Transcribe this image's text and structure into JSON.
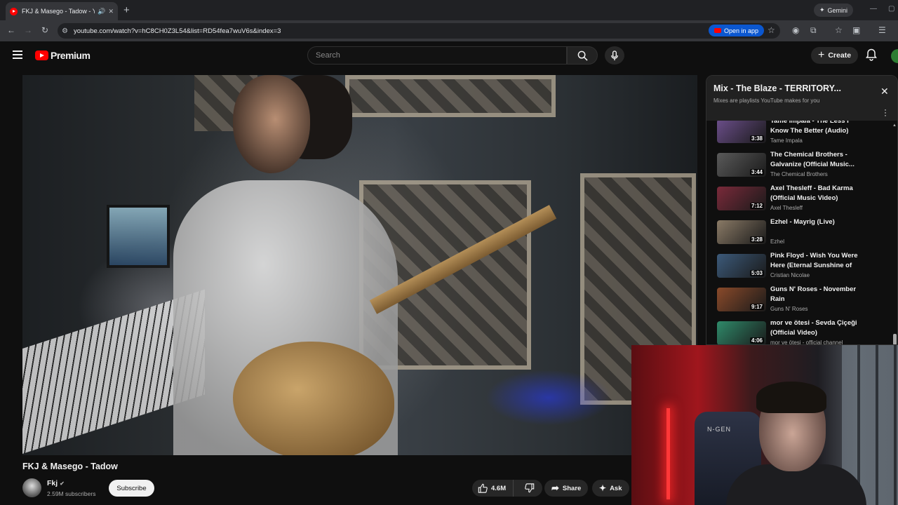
{
  "browser": {
    "tab_title": "FKJ & Masego - Tadow - YouTube",
    "new_tab": "+",
    "gemini_label": "Gemini",
    "url": "youtube.com/watch?v=hC8CH0Z3L54&list=RD54fea7wuV6s&index=3",
    "open_in_app": "Open in app"
  },
  "masthead": {
    "logo_text": "Premium",
    "search_placeholder": "Search",
    "create_label": "Create"
  },
  "video": {
    "title": "FKJ & Masego - Tadow",
    "channel": "Fkj",
    "subscribers": "2.59M subscribers",
    "subscribe_label": "Subscribe",
    "likes": "4.6M",
    "share_label": "Share",
    "ask_label": "Ask"
  },
  "webcam": {
    "chair_brand": "N-GEN"
  },
  "playlist": {
    "title": "Mix - The Blaze - TERRITORY...",
    "subtitle": "Mixes are playlists YouTube makes for you",
    "items": [
      {
        "title": "Tame Impala - The Less I Know The Better (Audio)",
        "channel": "Tame Impala",
        "duration": "3:38",
        "color": "#6b4e8a"
      },
      {
        "title": "The Chemical Brothers - Galvanize (Official Music...",
        "channel": "The Chemical Brothers",
        "duration": "3:44",
        "color": "#5a5a5a"
      },
      {
        "title": "Axel Thesleff - Bad Karma (Official Music Video)",
        "channel": "Axel Thesleff",
        "duration": "7:12",
        "color": "#7a2a3a"
      },
      {
        "title": "Ezhel - Mayrig (Live)",
        "channel": "Ezhel",
        "duration": "3:28",
        "color": "#8a7a66"
      },
      {
        "title": "Pink Floyd - Wish You Were Here (Eternal Sunshine of the...",
        "channel": "Cristian Nicolae",
        "duration": "5:03",
        "color": "#3c5a7a"
      },
      {
        "title": "Guns N' Roses - November Rain",
        "channel": "Guns N' Roses",
        "duration": "9:17",
        "color": "#8a4a2a"
      },
      {
        "title": "mor ve ötesi - Sevda Çiçeği (Official Video)",
        "channel": "mor ve ötesi - official channel",
        "duration": "4:06",
        "color": "#2f8a6a"
      }
    ]
  }
}
